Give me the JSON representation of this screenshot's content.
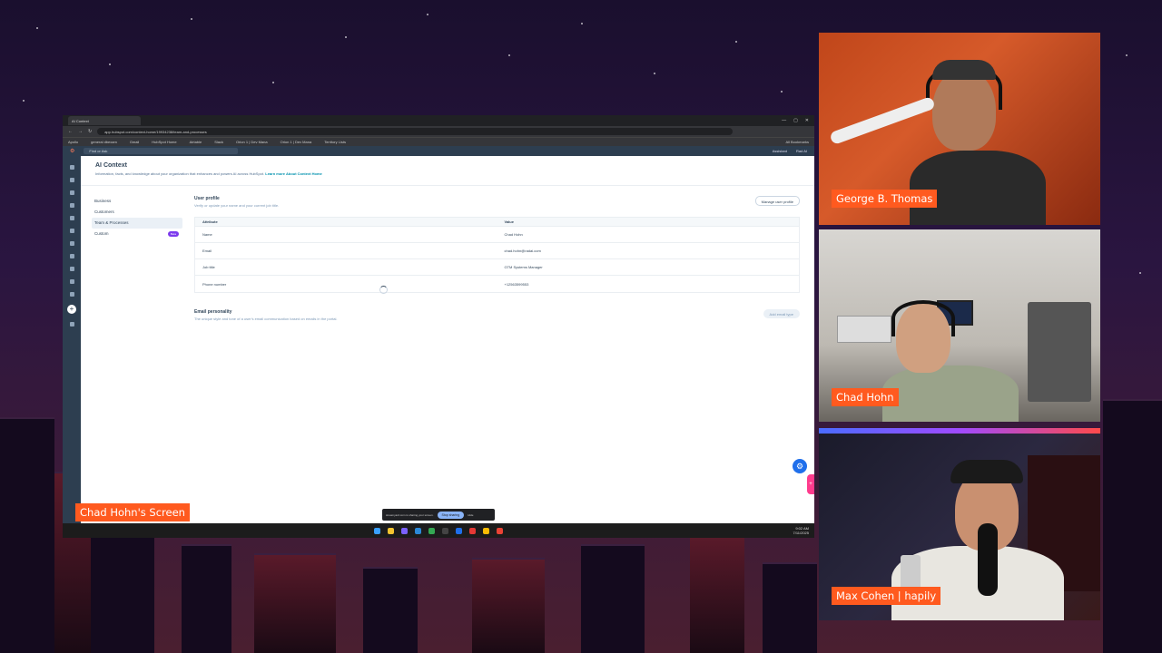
{
  "browser": {
    "tab_label": "AI Context",
    "url": "app.hubspot.com/context-home/19934238/team-and-processes",
    "bookmarks": [
      "Apollo",
      "general dbexam",
      "Gmail",
      "HubSpot Home",
      "Airtable",
      "Slack",
      "Orion 1 | Dev Mana",
      "Orion 1 | Dev Mana",
      "Territory Lists"
    ],
    "bookmarks_folder": "All Bookmarks"
  },
  "hubspot": {
    "search_placeholder": "Find or Ask",
    "assistant_label": "Assistant",
    "account_label": "Rad AI"
  },
  "page": {
    "title": "AI Context",
    "subtitle": "Information, facts, and knowledge about your organization that enhances and powers AI across HubSpot.",
    "learn_more": "Learn more About Context Home"
  },
  "side_nav": [
    {
      "label": "Business"
    },
    {
      "label": "Customers"
    },
    {
      "label": "Team & Processes"
    },
    {
      "label": "Custom",
      "badge": "Beta"
    }
  ],
  "user_profile": {
    "title": "User profile",
    "subtitle": "Verify or update your name and your current job title.",
    "manage_button": "Manage user profile",
    "columns": [
      "Attribute",
      "Value"
    ],
    "rows": [
      [
        "Name",
        "Chad Hohn"
      ],
      [
        "Email",
        "chad.hohn@radai.com"
      ],
      [
        "Job title",
        "GTM Systems Manager"
      ],
      [
        "Phone number",
        "+12563599553"
      ]
    ]
  },
  "email_personality": {
    "title": "Email personality",
    "subtitle": "The unique style and tone of a user's email communication based on emails in the portal.",
    "add_button": "Add email type"
  },
  "share_bar": {
    "text": "streamyard.com is sharing your screen.",
    "stop_label": "Stop sharing",
    "hide_label": "Hide"
  },
  "clock": {
    "time": "9:02 AM",
    "date": "7/11/2025"
  },
  "overlays": {
    "screen_label": "Chad Hohn's Screen",
    "cam1_name": "George B. Thomas",
    "cam2_name": "Chad Hohn",
    "cam3_name": "Max Cohen | hapily"
  },
  "colors": {
    "accent": "#ff5a1f",
    "hubspot_nav": "#2d3e50",
    "link": "#0091ae"
  }
}
